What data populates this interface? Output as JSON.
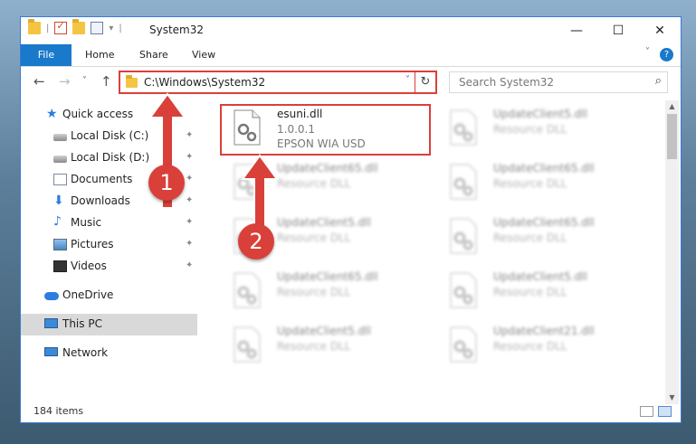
{
  "window": {
    "title": "System32"
  },
  "ribbon": {
    "tabs": [
      "File",
      "Home",
      "Share",
      "View"
    ]
  },
  "address": {
    "path": "C:\\Windows\\System32"
  },
  "search": {
    "placeholder": "Search System32"
  },
  "sidebar": {
    "items": [
      {
        "label": "Quick access",
        "icon": "star-icon"
      },
      {
        "label": "Local Disk (C:)",
        "icon": "drive-icon"
      },
      {
        "label": "Local Disk (D:)",
        "icon": "drive-icon"
      },
      {
        "label": "Documents",
        "icon": "documents-icon"
      },
      {
        "label": "Downloads",
        "icon": "downloads-icon"
      },
      {
        "label": "Music",
        "icon": "music-icon"
      },
      {
        "label": "Pictures",
        "icon": "pictures-icon"
      },
      {
        "label": "Videos",
        "icon": "videos-icon"
      },
      {
        "label": "OneDrive",
        "icon": "cloud-icon"
      },
      {
        "label": "This PC",
        "icon": "computer-icon",
        "selected": true
      },
      {
        "label": "Network",
        "icon": "network-icon"
      }
    ]
  },
  "files": [
    {
      "name": "esuni.dll",
      "line2": "1.0.0.1",
      "line3": "EPSON WIA USD",
      "blurred": false,
      "highlighted": true
    },
    {
      "name": "UpdateClient5.dll",
      "line2": "Resource DLL",
      "blurred": true
    },
    {
      "name": "UpdateClient65.dll",
      "line2": "Resource DLL",
      "blurred": true
    },
    {
      "name": "UpdateClient65.dll",
      "line2": "Resource DLL",
      "blurred": true
    },
    {
      "name": "UpdateClient5.dll",
      "line2": "Resource DLL",
      "blurred": true
    },
    {
      "name": "UpdateClient65.dll",
      "line2": "Resource DLL",
      "blurred": true
    },
    {
      "name": "UpdateClient65.dll",
      "line2": "Resource DLL",
      "blurred": true
    },
    {
      "name": "UpdateClient5.dll",
      "line2": "Resource DLL",
      "blurred": true
    },
    {
      "name": "UpdateClient5.dll",
      "line2": "Resource DLL",
      "blurred": true
    },
    {
      "name": "UpdateClient21.dll",
      "line2": "Resource DLL",
      "blurred": true
    }
  ],
  "status": {
    "item_count": "184 items"
  },
  "annotations": {
    "badge1": "1",
    "badge2": "2",
    "color": "#d9403a"
  },
  "colors": {
    "accent": "#1979ca",
    "highlight": "#d9403a"
  }
}
